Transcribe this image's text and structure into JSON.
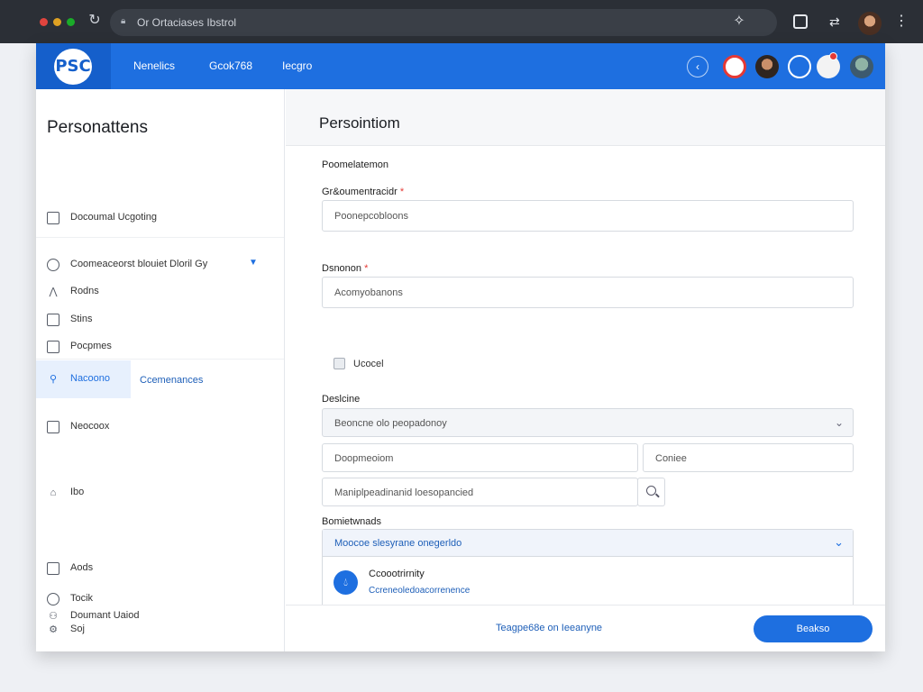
{
  "browser": {
    "url": "Or Ortaciases Ibstrol",
    "traffic_lights": [
      "#e0443e",
      "#dea123",
      "#1aab29"
    ]
  },
  "appbar": {
    "logo_text": "PSC",
    "nav": [
      "Nenelics",
      "Gcok768",
      "Iecgro"
    ],
    "accent": "#1e6fe0"
  },
  "sidebar": {
    "title": "Personattens",
    "items": [
      {
        "label": "Docoumal Ucgoting",
        "icon": "document-icon"
      },
      {
        "label": "Coomeaceorst  blouiet Dloril Gy",
        "icon": "circle-icon"
      },
      {
        "label": "Rodns",
        "icon": "share-icon"
      },
      {
        "label": "Stins",
        "icon": "mail-icon"
      },
      {
        "label": "Pocpmes",
        "icon": "folder-icon"
      },
      {
        "label": "Nacoono",
        "icon": "person-icon",
        "aside": "Ccemenances"
      },
      {
        "label": "Neocoox",
        "icon": "document-icon"
      },
      {
        "label": "Ibo",
        "icon": "home-icon"
      },
      {
        "label": "Aods",
        "icon": "card-icon"
      },
      {
        "label": "Tocik",
        "icon": "circle-icon"
      },
      {
        "label": "Soj",
        "icon": "settings-icon"
      },
      {
        "label": "Doumant Uaiod",
        "icon": "user-icon"
      }
    ]
  },
  "main": {
    "title": "Persointiom",
    "section_label": "Poomelatemon",
    "field1": {
      "label": "Gr&oumentracidr",
      "placeholder": "Poonepcobloons"
    },
    "field2": {
      "label": "Dsnonon",
      "placeholder": "Acomyobanons"
    },
    "checkbox_label": "Ucocel",
    "section2_label": "Deslcine",
    "select": {
      "value": "Beoncne olo peopadonoy"
    },
    "field3": {
      "placeholder": "Doopmeoiom"
    },
    "field4": {
      "placeholder": "Coniee"
    },
    "field5": {
      "placeholder": "Maniplpeadinanid loesopancied"
    },
    "section3_label": "Bomietwnads",
    "panel": {
      "header": "Moocoe slesyrane onegerldo",
      "item_title": "Ccoootrirnity",
      "item_subtitle": "Ccreneoledoacorrenence"
    },
    "footer": {
      "link": "Teagpe68e  on  Ieeanyne",
      "button": "Beakso"
    }
  }
}
